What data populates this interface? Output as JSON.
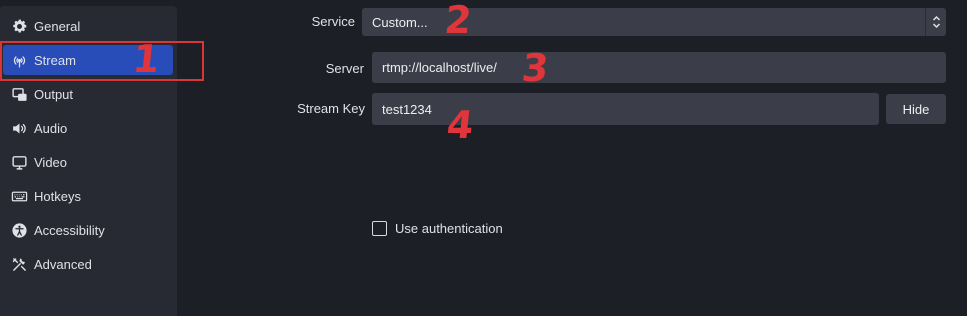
{
  "sidebar": {
    "items": [
      {
        "label": "General",
        "icon": "gear-icon"
      },
      {
        "label": "Stream",
        "icon": "antenna-icon",
        "active": true
      },
      {
        "label": "Output",
        "icon": "output-icon"
      },
      {
        "label": "Audio",
        "icon": "speaker-icon"
      },
      {
        "label": "Video",
        "icon": "monitor-icon"
      },
      {
        "label": "Hotkeys",
        "icon": "keyboard-icon"
      },
      {
        "label": "Accessibility",
        "icon": "accessibility-icon"
      },
      {
        "label": "Advanced",
        "icon": "tools-icon"
      }
    ]
  },
  "form": {
    "service_label": "Service",
    "service_value": "Custom...",
    "server_label": "Server",
    "server_value": "rtmp://localhost/live/",
    "stream_key_label": "Stream Key",
    "stream_key_value": "test1234",
    "hide_button": "Hide",
    "use_auth_label": "Use authentication",
    "use_auth_checked": false
  },
  "annotations": {
    "one": "1",
    "two": "2",
    "three": "3",
    "four": "4"
  },
  "colors": {
    "background": "#1d1f26",
    "sidebar": "#272a33",
    "active": "#284cb8",
    "field": "#3b3e48",
    "annotation": "#e0353a"
  }
}
